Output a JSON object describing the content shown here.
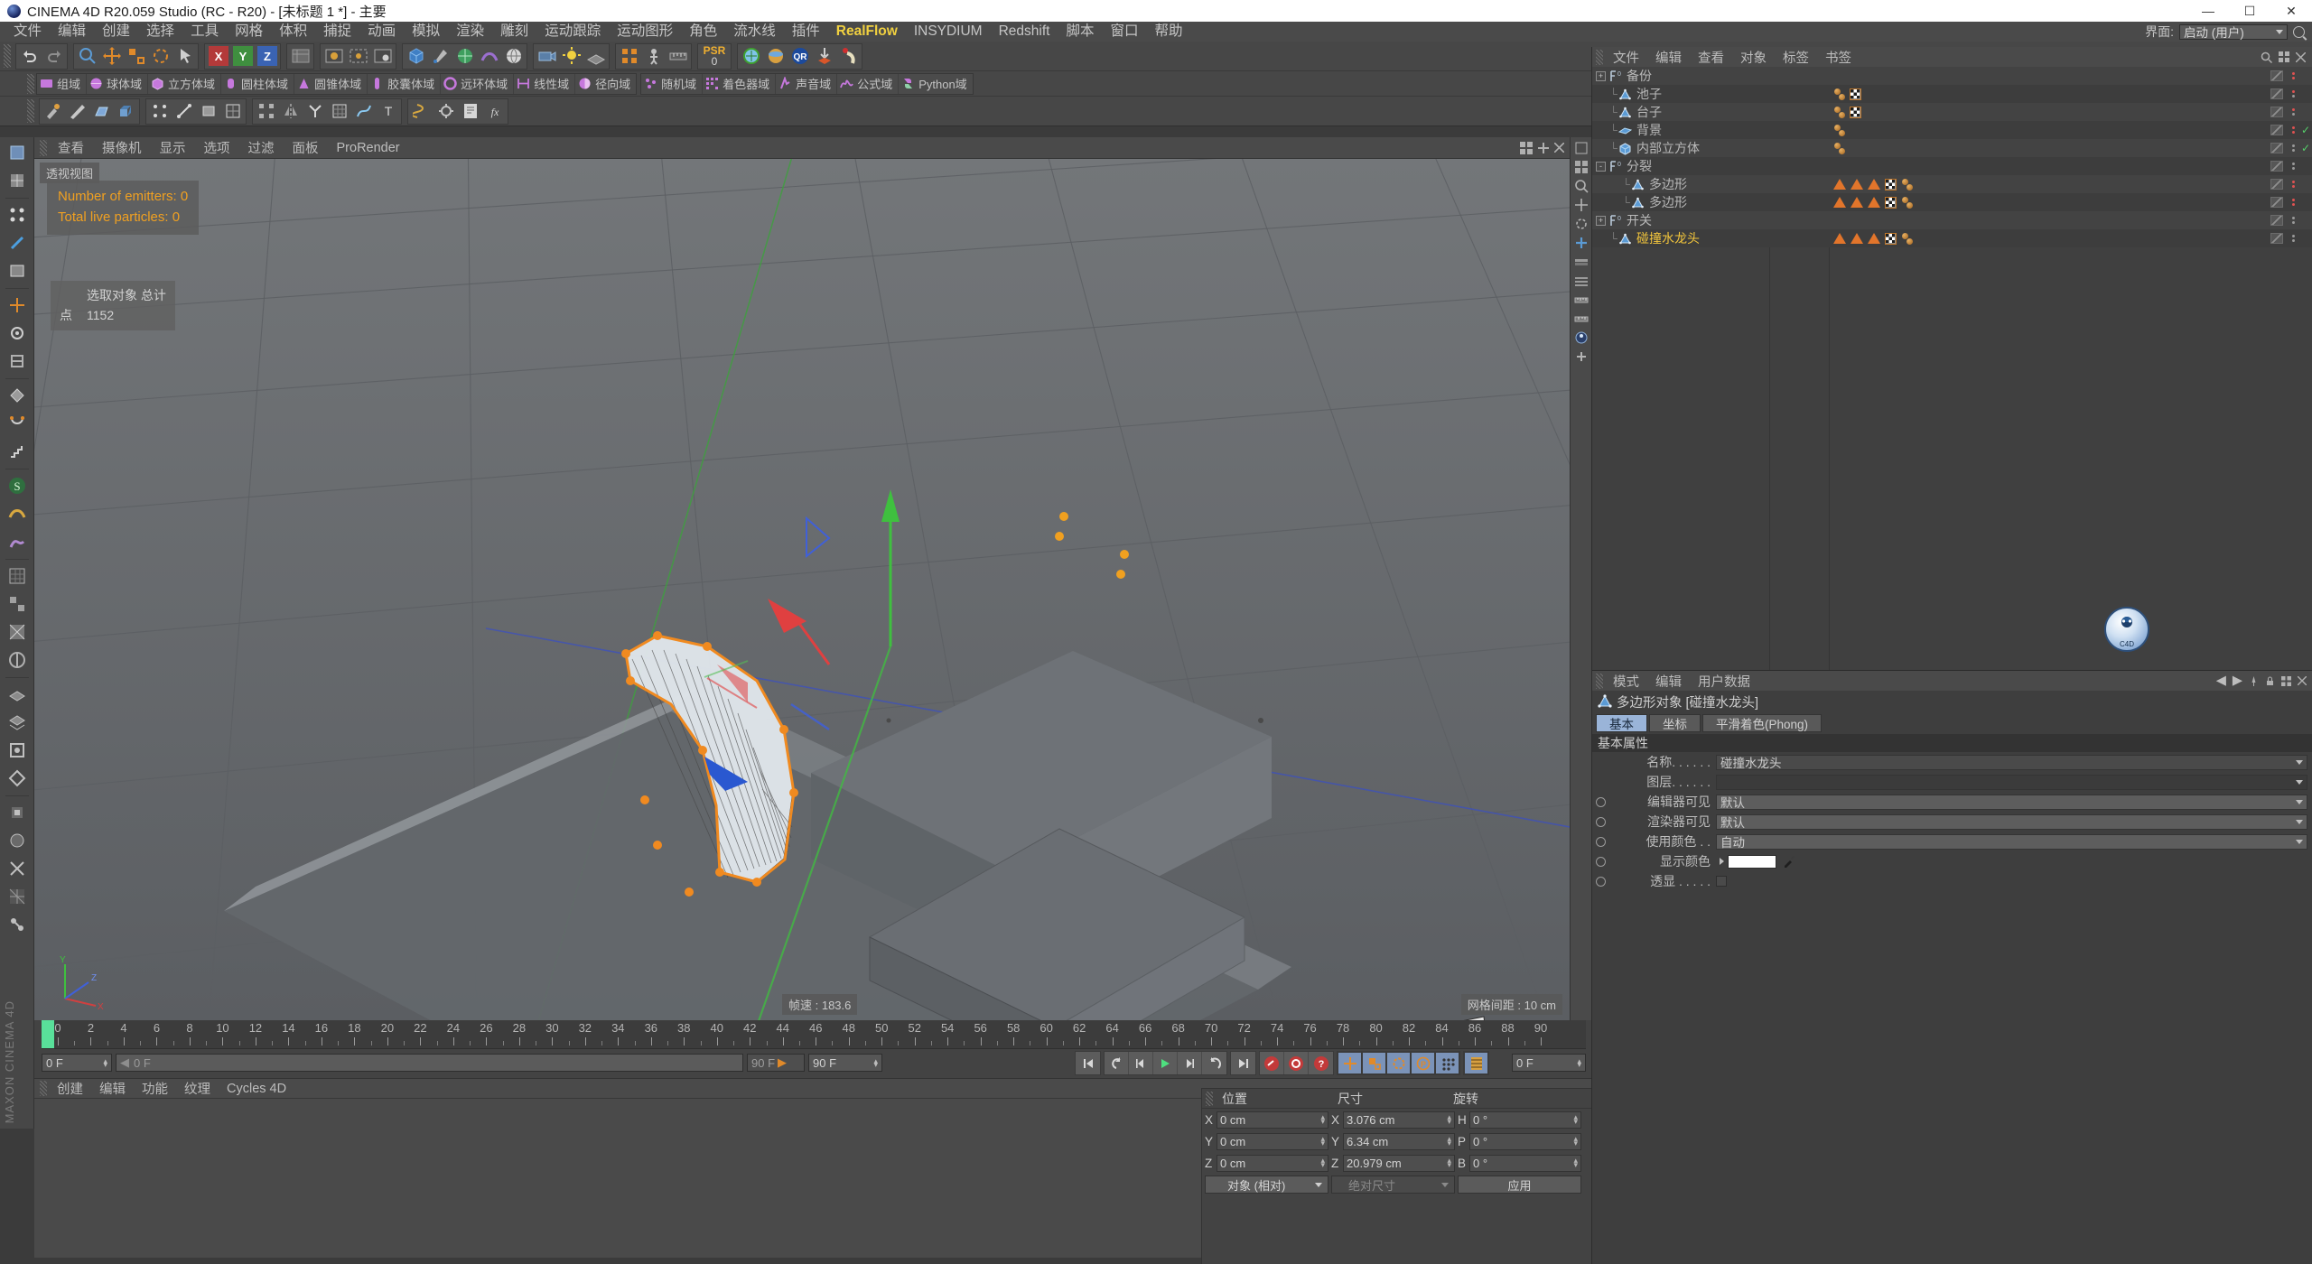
{
  "titlebar": {
    "title": "CINEMA 4D R20.059 Studio (RC - R20) - [未标题 1 *] - 主要",
    "minimize": "—",
    "maximize": "☐",
    "close": "✕"
  },
  "menubar": {
    "items": [
      {
        "label": "文件"
      },
      {
        "label": "编辑"
      },
      {
        "label": "创建"
      },
      {
        "label": "选择"
      },
      {
        "label": "工具"
      },
      {
        "label": "网格"
      },
      {
        "label": "体积"
      },
      {
        "label": "捕捉"
      },
      {
        "label": "动画"
      },
      {
        "label": "模拟"
      },
      {
        "label": "渲染"
      },
      {
        "label": "雕刻"
      },
      {
        "label": "运动跟踪"
      },
      {
        "label": "运动图形"
      },
      {
        "label": "角色"
      },
      {
        "label": "流水线"
      },
      {
        "label": "插件"
      },
      {
        "label": "RealFlow",
        "highlight": true
      },
      {
        "label": "INSYDIUM"
      },
      {
        "label": "Redshift"
      },
      {
        "label": "脚本"
      },
      {
        "label": "窗口"
      },
      {
        "label": "帮助"
      }
    ],
    "layout_label": "界面:",
    "layout_value": "启动 (用户)"
  },
  "toolbar_main": {
    "psr_label": "PSR",
    "psr_value": "0"
  },
  "field_toolbar": {
    "items": [
      {
        "label": "组域",
        "color": "#c678dd"
      },
      {
        "label": "球体域",
        "color": "#c678dd"
      },
      {
        "label": "立方体域",
        "color": "#c678dd"
      },
      {
        "label": "圆柱体域",
        "color": "#c678dd"
      },
      {
        "label": "圆锥体域",
        "color": "#c678dd"
      },
      {
        "label": "胶囊体域",
        "color": "#c678dd"
      },
      {
        "label": "远环体域",
        "color": "#c678dd"
      },
      {
        "label": "线性域",
        "color": "#c678dd"
      },
      {
        "label": "径向域",
        "color": "#c678dd"
      },
      {
        "label": "随机域",
        "color": "#c678dd"
      },
      {
        "label": "着色器域",
        "color": "#c678dd"
      },
      {
        "label": "声音域",
        "color": "#c678dd"
      },
      {
        "label": "公式域",
        "color": "#c678dd"
      },
      {
        "label": "Python域",
        "color": "#c678dd"
      }
    ]
  },
  "viewport": {
    "menu": [
      "查看",
      "摄像机",
      "显示",
      "选项",
      "过滤",
      "面板",
      "ProRender"
    ],
    "view_label": "透视视图",
    "overlay": {
      "line1": "Number of emitters: 0",
      "line2": "Total live particles: 0"
    },
    "selection_info": {
      "title": "选取对象 总计",
      "points_label": "点",
      "points_value": "1152"
    },
    "fps_label": "帧速 : 183.6",
    "grid_label": "网格间距 : 10 cm",
    "axis_x": "X",
    "axis_y": "Y",
    "axis_z": "Z"
  },
  "timeline": {
    "ticks": [
      0,
      2,
      4,
      6,
      8,
      10,
      12,
      14,
      16,
      18,
      20,
      22,
      24,
      26,
      28,
      30,
      32,
      34,
      36,
      38,
      40,
      42,
      44,
      46,
      48,
      50,
      52,
      54,
      56,
      58,
      60,
      62,
      64,
      66,
      68,
      70,
      72,
      74,
      76,
      78,
      80,
      82,
      84,
      86,
      88,
      90
    ],
    "range_start": 0,
    "range_end": 90,
    "current_frame": "0 F",
    "field_start": "0 F",
    "field_strip": "0 F",
    "field_end_small": "90 F",
    "field_end": "90 F",
    "field_right": "0 F"
  },
  "material_manager": {
    "menu": [
      "创建",
      "编辑",
      "功能",
      "纹理",
      "Cycles 4D"
    ]
  },
  "watermark": "MAXON CINEMA 4D",
  "object_manager": {
    "menu": [
      "文件",
      "编辑",
      "查看",
      "对象",
      "标签",
      "书签"
    ],
    "rows": [
      {
        "label": "备份",
        "depth": 0,
        "expander": "+",
        "icon": "layer-icon",
        "dots": "red",
        "check": false,
        "tags": []
      },
      {
        "label": "池子",
        "depth": 1,
        "expander": "",
        "icon": "polygon-icon",
        "dots": "red-single",
        "check": false,
        "tags": [
          "sphere",
          "checker"
        ]
      },
      {
        "label": "台子",
        "depth": 1,
        "expander": "",
        "icon": "polygon-icon",
        "dots": "red-single",
        "check": false,
        "tags": [
          "sphere",
          "checker"
        ]
      },
      {
        "label": "背景",
        "depth": 1,
        "expander": "",
        "icon": "plane-icon",
        "dots": "red",
        "check": true,
        "tags": [
          "sphere"
        ]
      },
      {
        "label": "内部立方体",
        "depth": 1,
        "expander": "",
        "icon": "cube-icon",
        "dots": "gray",
        "check": true,
        "tags": [
          "sphere"
        ]
      },
      {
        "label": "分裂",
        "depth": 0,
        "expander": "-",
        "icon": "layer-icon",
        "dots": "gray",
        "check": false,
        "tags": []
      },
      {
        "label": "多边形",
        "depth": 2,
        "expander": "",
        "icon": "polygon-icon",
        "dots": "red",
        "check": false,
        "tags": [
          "tri",
          "tri",
          "tri",
          "checker",
          "sphere"
        ]
      },
      {
        "label": "多边形",
        "depth": 2,
        "expander": "",
        "icon": "polygon-icon",
        "dots": "red",
        "check": false,
        "tags": [
          "tri",
          "tri",
          "tri",
          "checker",
          "sphere"
        ]
      },
      {
        "label": "开关",
        "depth": 0,
        "expander": "+",
        "icon": "layer-icon",
        "dots": "gray",
        "check": false,
        "tags": []
      },
      {
        "label": "碰撞水龙头",
        "depth": 1,
        "expander": "",
        "icon": "polygon-icon",
        "dots": "gray",
        "check": false,
        "selected": true,
        "tags": [
          "tri",
          "tri",
          "tri",
          "checker",
          "sphere"
        ]
      }
    ]
  },
  "attribute_manager": {
    "menu": [
      "模式",
      "编辑",
      "用户数据"
    ],
    "object_title": "多边形对象 [碰撞水龙头]",
    "tabs": [
      {
        "label": "基本",
        "active": true
      },
      {
        "label": "坐标",
        "active": false
      },
      {
        "label": "平滑着色(Phong)",
        "active": false
      }
    ],
    "section": "基本属性",
    "fields": [
      {
        "label": "名称. . . . . .",
        "value": "碰撞水龙头",
        "type": "text"
      },
      {
        "label": "图层. . . . . .",
        "value": "",
        "type": "dark"
      },
      {
        "label": "编辑器可见",
        "value": "默认",
        "type": "select",
        "radio": true
      },
      {
        "label": "渲染器可见",
        "value": "默认",
        "type": "select",
        "radio": true
      },
      {
        "label": "使用颜色 . .",
        "value": "自动",
        "type": "select",
        "radio": true
      },
      {
        "label": "显示颜色",
        "value": "",
        "type": "color",
        "radio": true,
        "color": "#ffffff"
      },
      {
        "label": "透显 . . . . .",
        "value": "",
        "type": "checkbox",
        "radio": true
      }
    ]
  },
  "coordinate_manager": {
    "headers": [
      "位置",
      "尺寸",
      "旋转"
    ],
    "rows": [
      {
        "a1": "X",
        "v1": "0 cm",
        "a2": "X",
        "v2": "3.076 cm",
        "a3": "H",
        "v3": "0 °"
      },
      {
        "a1": "Y",
        "v1": "0 cm",
        "a2": "Y",
        "v2": "6.34 cm",
        "a3": "P",
        "v3": "0 °"
      },
      {
        "a1": "Z",
        "v1": "0 cm",
        "a2": "Z",
        "v2": "20.979 cm",
        "a3": "B",
        "v3": "0 °"
      }
    ],
    "mode_select": "对象 (相对)",
    "size_select": "绝对尺寸",
    "apply_button": "应用"
  },
  "nav_gizmo": {
    "label": "C4D"
  },
  "colors": {
    "accent_yellow": "#f2c53c",
    "accent_orange": "#e2752b",
    "panel_bg": "#3e3e3e",
    "toolbar_bg": "#474747",
    "tab_active": "#9ab4d8",
    "playhead_green": "#59e09a",
    "field_purple": "#c678dd"
  }
}
